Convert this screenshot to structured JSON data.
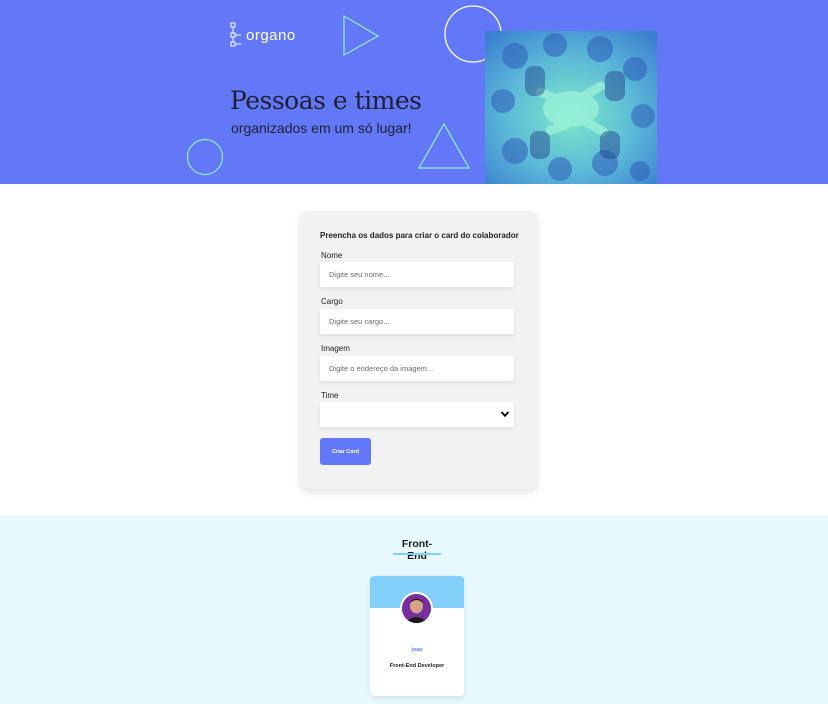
{
  "banner": {
    "logo_text": "organo",
    "headline": "Pessoas e times",
    "subline": "organizados em um só lugar!",
    "background_color": "#6278f7"
  },
  "form": {
    "title": "Preencha os dados para criar o card do colaborador",
    "fields": [
      {
        "label": "Nome",
        "placeholder": "Digite seu nome..."
      },
      {
        "label": "Cargo",
        "placeholder": "Digite seu cargo..."
      },
      {
        "label": "Imagem",
        "placeholder": "Digite o endereço da imagem..."
      }
    ],
    "select": {
      "label": "Time",
      "value": ""
    },
    "submit_label": "Criar Card",
    "accent_color": "#6278f7"
  },
  "teams": [
    {
      "name": "Front-End",
      "primary_color": "#82cffa",
      "secondary_color": "#e8f8ff",
      "members": [
        {
          "name": "joao",
          "role": "Front-End Developer"
        }
      ]
    }
  ],
  "icons": {
    "logo": "organo-logo-icon",
    "select_arrow": "chevron-down-icon"
  }
}
